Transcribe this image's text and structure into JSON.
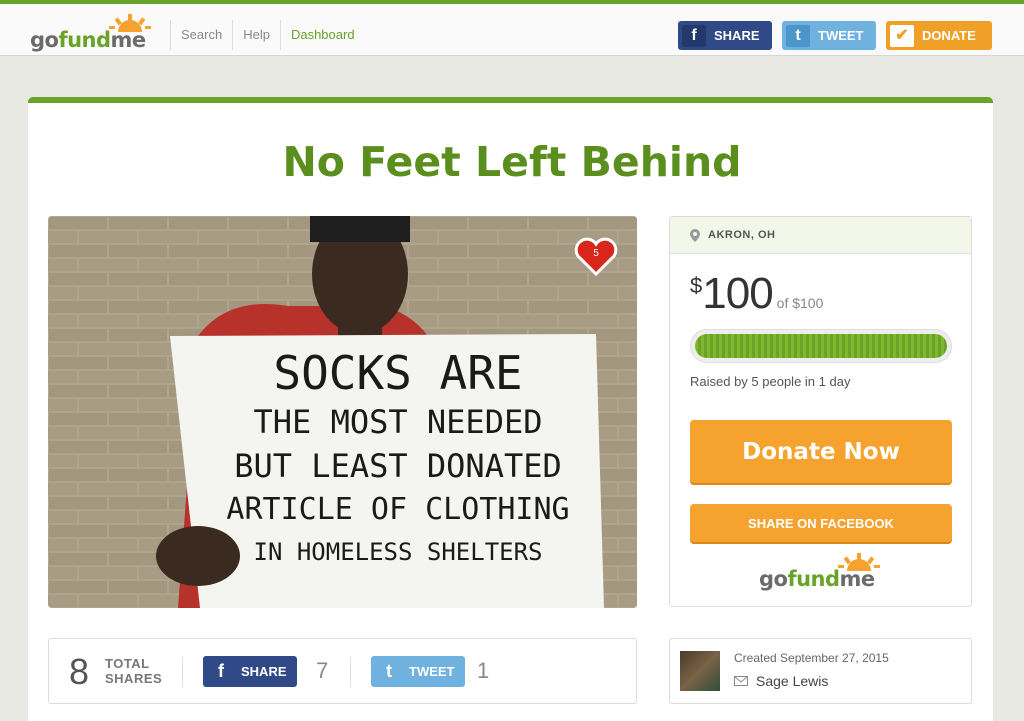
{
  "header": {
    "logo": {
      "go": "go",
      "fund": "fund",
      "me": "me"
    },
    "nav": [
      "Search",
      "Help",
      "Dashboard"
    ],
    "buttons": {
      "share": "SHARE",
      "tweet": "TWEET",
      "donate": "DONATE"
    }
  },
  "campaign": {
    "title": "No Feet Left Behind",
    "hero_sign": [
      "SOCKS ARE",
      "THE MOST NEEDED",
      "BUT LEAST DONATED",
      "ARTICLE OF CLOTHING",
      "IN HOMELESS SHELTERS"
    ],
    "heart_count": "5"
  },
  "sidebar": {
    "location": "AKRON, OH",
    "currency": "$",
    "raised": "100",
    "goal": "of $100",
    "progress_fraction": 1.0,
    "raised_by": "Raised by 5 people in 1 day",
    "donate_now": "Donate Now",
    "share_on_facebook": "SHARE ON FACEBOOK"
  },
  "shares": {
    "total": "8",
    "total_label_1": "TOTAL",
    "total_label_2": "SHARES",
    "fb_label": "SHARE",
    "fb_count": "7",
    "tw_label": "TWEET",
    "tw_count": "1"
  },
  "creator": {
    "created": "Created September 27, 2015",
    "name": "Sage Lewis"
  },
  "colors": {
    "brand_green": "#6aa329",
    "orange": "#f6a22f",
    "facebook": "#2f4a87",
    "twitter": "#6fb2df"
  }
}
